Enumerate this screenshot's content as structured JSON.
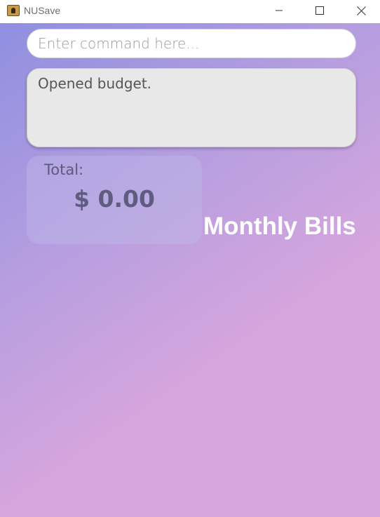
{
  "window": {
    "title": "NUSave",
    "controls": {
      "minimize": "minimize-icon",
      "maximize": "maximize-icon",
      "close": "close-icon"
    }
  },
  "command": {
    "placeholder": "Enter command here...",
    "value": ""
  },
  "result": {
    "message": "Opened budget."
  },
  "total": {
    "label": "Total:",
    "amount": "$ 0.00"
  },
  "budget": {
    "name": "Monthly Bills"
  },
  "colors": {
    "gradient_start": "#8f8fe0",
    "gradient_end": "#d6a5dd",
    "result_bg": "#e8e8e8",
    "total_text": "#5f5c80"
  }
}
